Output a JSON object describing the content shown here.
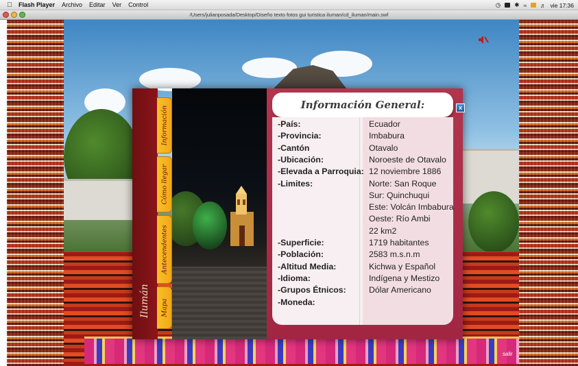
{
  "menubar": {
    "app_name": "Flash Player",
    "menus": [
      "Archivo",
      "Editar",
      "Ver",
      "Control"
    ],
    "clock": "vie 17:36"
  },
  "window": {
    "title": "/Users/julianposada/Desktop/Diseño texto fotos gui turistica iluman/cd_iluman/main.swf"
  },
  "sidebar": {
    "tabs": [
      "Información",
      "Cómo llegar",
      "Antecendentes",
      "Mapa"
    ],
    "logo": "Ilumán"
  },
  "panel": {
    "title": "Información General:",
    "close_label": "x",
    "labels": [
      "-País:",
      "-Provincia:",
      "-Cantón",
      "-Ubicación:",
      "-Elevada a Parroquia:",
      "-Limites:",
      "-Superficie:",
      "-Población:",
      "-Altitud Media:",
      "-Idioma:",
      "-Grupos Étnicos:",
      "-Moneda:"
    ],
    "values": [
      "Ecuador",
      "Imbabura",
      "Otavalo",
      "Noroeste de Otavalo",
      "12 noviembre 1886",
      "Norte: San Roque",
      "Sur: Quinchuqui",
      "Este: Volcán Imbabura",
      "Oeste: Río Ambi",
      "22 km2",
      "1719 habitantes",
      "2583 m.s.n.m",
      "Kichwa y Español",
      "Indígena y Mestizo",
      "Dólar Americano"
    ]
  },
  "footer": {
    "exit_label": "salir"
  },
  "colors": {
    "panel": "#a8294a",
    "strip": "#7a1116",
    "tab": "#f5b521",
    "close": "#2a6db8"
  }
}
